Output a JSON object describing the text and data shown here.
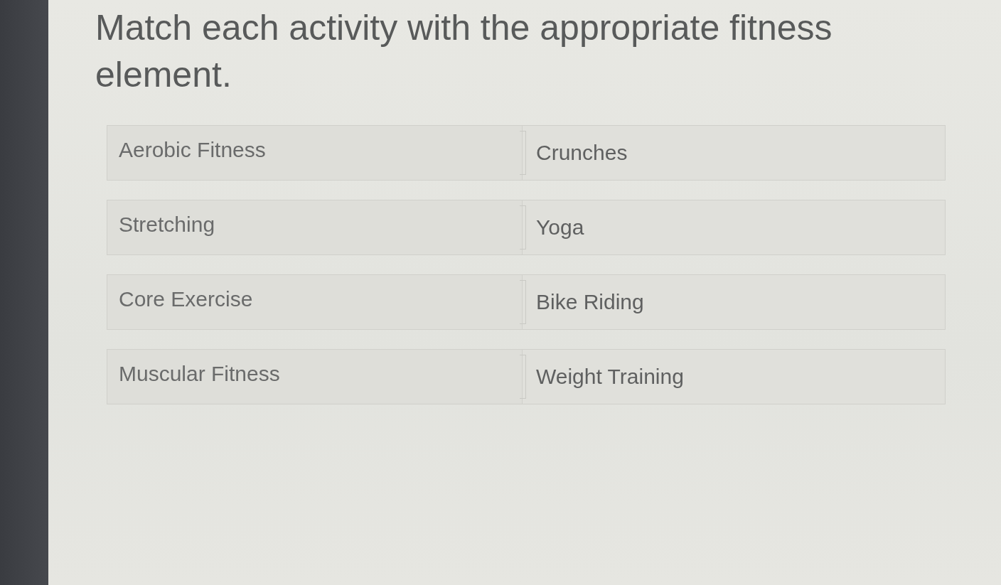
{
  "question": {
    "title": "Match each activity with the appropriate fitness element."
  },
  "pairs": [
    {
      "prompt": "Aerobic Fitness",
      "answer": "Crunches"
    },
    {
      "prompt": "Stretching",
      "answer": "Yoga"
    },
    {
      "prompt": "Core Exercise",
      "answer": "Bike Riding"
    },
    {
      "prompt": "Muscular Fitness",
      "answer": "Weight Training"
    }
  ]
}
